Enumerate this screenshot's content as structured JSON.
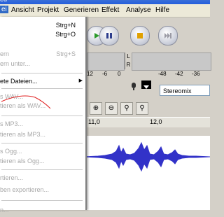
{
  "window": {
    "title_fragment": "ed"
  },
  "menubar": {
    "items": [
      {
        "label": "ei"
      },
      {
        "label": "Ansicht"
      },
      {
        "label": "Projekt"
      },
      {
        "label": "Generieren"
      },
      {
        "label": "Effekt"
      },
      {
        "label": "Analyse"
      },
      {
        "label": "Hilfe"
      }
    ]
  },
  "file_menu": {
    "items": [
      {
        "label": "",
        "shortcut": "Strg+N"
      },
      {
        "label": "",
        "shortcut": "Strg+O"
      },
      {
        "label": "ern",
        "shortcut": "Strg+S"
      },
      {
        "label": "ern unter..."
      },
      {
        "label": "ete Dateien..."
      },
      {
        "label": "s WAV..."
      },
      {
        "label": "tieren als WAV..."
      },
      {
        "label": "s MP3..."
      },
      {
        "label": "tieren als MP3..."
      },
      {
        "label": "s Ogg..."
      },
      {
        "label": "tieren als Ogg..."
      },
      {
        "label": "rtieren..."
      },
      {
        "label": "ben exportieren..."
      },
      {
        "label": "n..."
      }
    ]
  },
  "meter": {
    "left_label": "L",
    "right_label": "R"
  },
  "scale_left": [
    "12",
    "-6",
    "0"
  ],
  "scale_right": [
    "-48",
    "-42",
    "-36"
  ],
  "mixer": {
    "selected_source": "Stereomix"
  },
  "ruler": {
    "labels": [
      "11,0",
      "12,0"
    ]
  },
  "colors": {
    "waveform": "#3232c8",
    "menu_highlight": "#316ac5",
    "annotation": "#e02020"
  },
  "icons": [
    "play-icon",
    "pause-icon",
    "stop-icon",
    "skip-end-icon",
    "microphone-icon",
    "zoom-in-icon",
    "zoom-out-icon",
    "fit-selection-icon",
    "fit-project-icon"
  ]
}
